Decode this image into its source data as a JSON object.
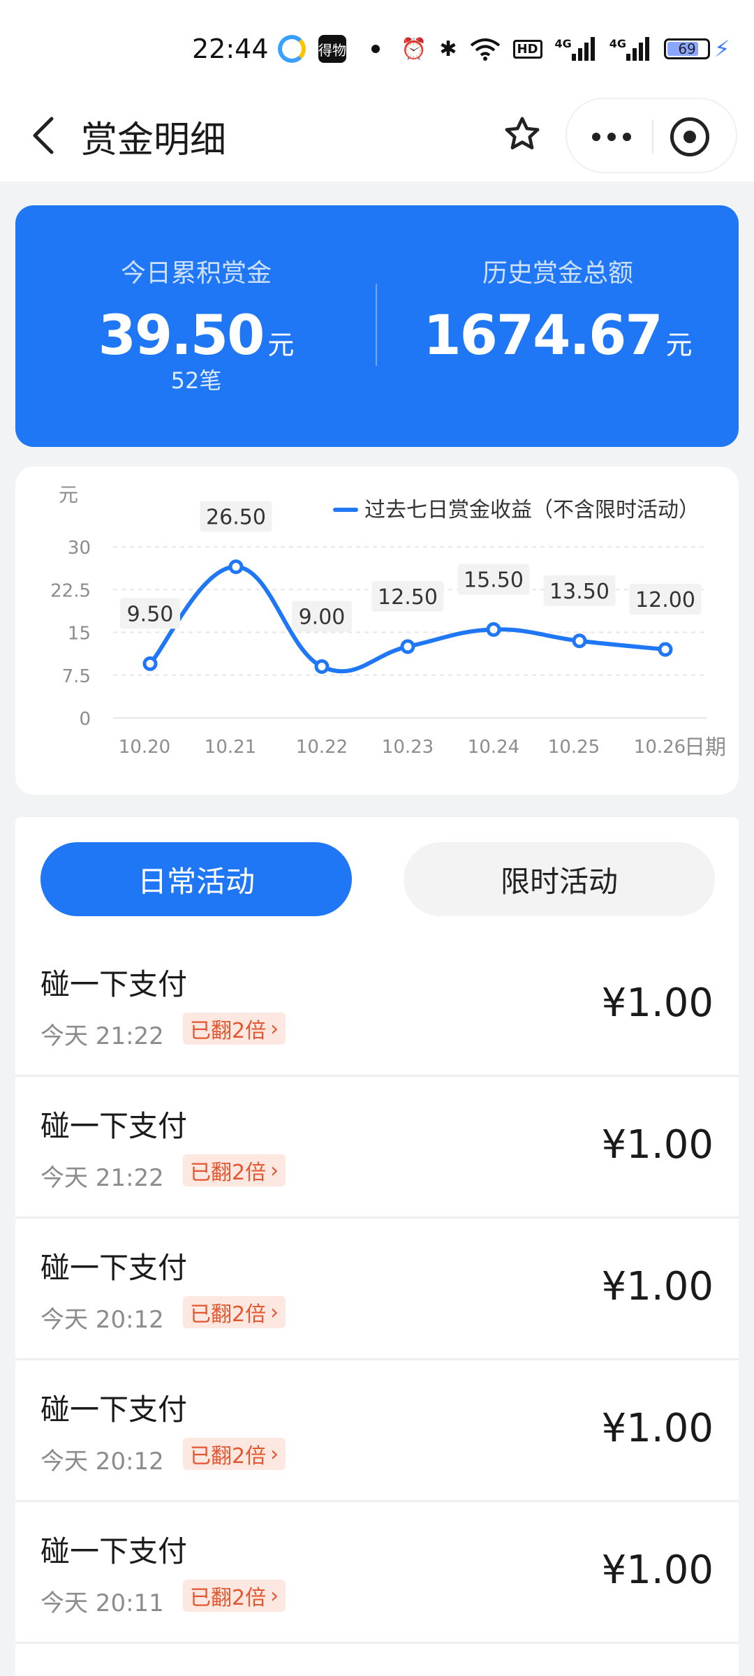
{
  "status_bar": {
    "time": "22:44",
    "app_badge": "得物",
    "hd_label": "HD",
    "signal_1": "4G",
    "signal_2": "4G",
    "battery": "69"
  },
  "header": {
    "title": "赏金明细"
  },
  "summary": {
    "today_label": "今日累积赏金",
    "today_value": "39.50",
    "today_unit": "元",
    "today_count": "52笔",
    "total_label": "历史赏金总额",
    "total_value": "1674.67",
    "total_unit": "元"
  },
  "chart_data": {
    "type": "line",
    "ylabel": "元",
    "xlabel": "日期",
    "legend": "过去七日赏金收益（不含限时活动）",
    "legend_position": "top-right",
    "categories": [
      "10.20",
      "10.21",
      "10.22",
      "10.23",
      "10.24",
      "10.25",
      "10.26"
    ],
    "values": [
      9.5,
      26.5,
      9.0,
      12.5,
      15.5,
      13.5,
      12.0
    ],
    "value_labels": [
      "9.50",
      "26.50",
      "9.00",
      "12.50",
      "15.50",
      "13.50",
      "12.00"
    ],
    "y_ticks": [
      "0",
      "7.5",
      "15",
      "22.5",
      "30"
    ],
    "y_tick_values": [
      0,
      7.5,
      15,
      22.5,
      30
    ],
    "ylim": [
      0,
      30
    ],
    "grid": true,
    "color": "#1f77f5"
  },
  "tabs": {
    "daily": "日常活动",
    "limited": "限时活动"
  },
  "records": [
    {
      "title": "碰一下支付",
      "time": "今天 21:22",
      "badge": "已翻2倍",
      "amount": "¥1.00"
    },
    {
      "title": "碰一下支付",
      "time": "今天 21:22",
      "badge": "已翻2倍",
      "amount": "¥1.00"
    },
    {
      "title": "碰一下支付",
      "time": "今天 20:12",
      "badge": "已翻2倍",
      "amount": "¥1.00"
    },
    {
      "title": "碰一下支付",
      "time": "今天 20:12",
      "badge": "已翻2倍",
      "amount": "¥1.00"
    },
    {
      "title": "碰一下支付",
      "time": "今天 20:11",
      "badge": "已翻2倍",
      "amount": "¥1.00"
    }
  ],
  "colors": {
    "accent": "#1f77f5",
    "badge_bg": "#fde8e1",
    "badge_text": "#e2572f"
  }
}
